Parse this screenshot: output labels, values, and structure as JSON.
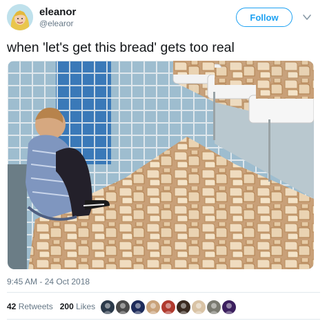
{
  "user": {
    "display_name": "eleanor",
    "handle": "@elearor",
    "avatar": "avatar"
  },
  "follow_button": {
    "label": "Follow"
  },
  "menu": {
    "icon": "chevron-down-icon"
  },
  "tweet": {
    "text": "when 'let's get this bread' gets too real",
    "timestamp": "9:45 AM - 24 Oct 2018"
  },
  "photo": {
    "description_icon": "photo"
  },
  "stats": {
    "retweets_count": "42",
    "retweets_label": "Retweets",
    "likes_count": "200",
    "likes_label": "Likes"
  },
  "likers": [
    {
      "color": "#2b3a4a"
    },
    {
      "color": "#4a4a4a"
    },
    {
      "color": "#1d2b5a"
    },
    {
      "color": "#c9a27a"
    },
    {
      "color": "#b03a2e"
    },
    {
      "color": "#3a2a20"
    },
    {
      "color": "#d9c3a5"
    },
    {
      "color": "#7a7a70"
    },
    {
      "color": "#3b1f5e"
    }
  ],
  "colors": {
    "accent": "#1da1f2",
    "text": "#14171a",
    "secondary": "#657786"
  }
}
